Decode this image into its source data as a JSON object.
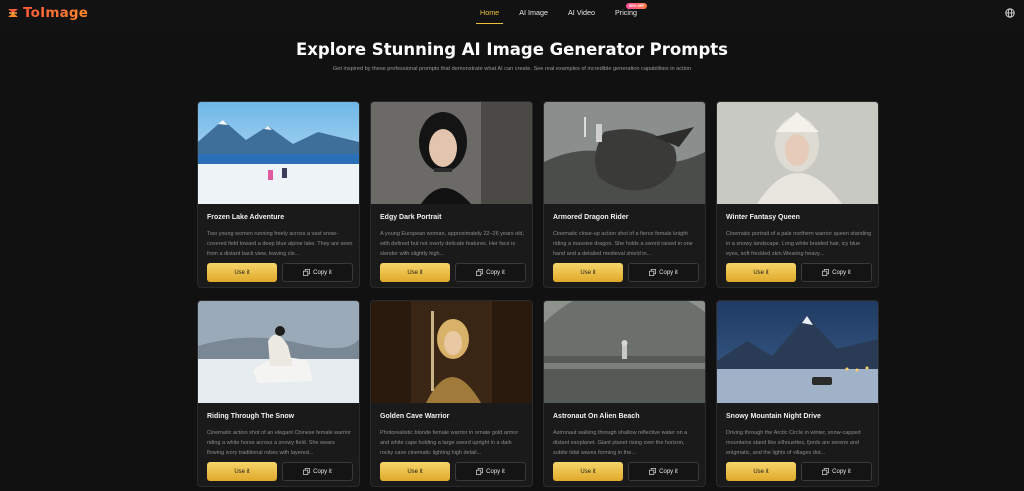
{
  "header": {
    "logo_text": "ToImage",
    "nav": [
      {
        "label": "Home",
        "active": true
      },
      {
        "label": "AI Image",
        "active": false
      },
      {
        "label": "AI Video",
        "active": false
      },
      {
        "label": "Pricing",
        "active": false
      }
    ],
    "pricing_badge": "50% OFF",
    "language_icon": "globe-icon"
  },
  "hero": {
    "title": "Explore Stunning AI Image Generator Prompts",
    "subtitle": "Get inspired by these professional prompts that demonstrate what AI can create. See real examples of incredible generation capabilities in action"
  },
  "buttons": {
    "use_label": "Use it",
    "copy_label": "Copy it",
    "copy_icon": "copy-icon"
  },
  "cards": [
    {
      "title": "Frozen Lake Adventure",
      "description": "Two young women running freely across a vast snow-covered field toward a deep blue alpine lake. They are seen from a distant back view, leaving cle..."
    },
    {
      "title": "Edgy Dark Portrait",
      "description": "A young European woman, approximately 22–26 years old, with defined but not overly delicate features. Her face is slender with slightly high..."
    },
    {
      "title": "Armored Dragon Rider",
      "description": "Cinematic close-up action shot of a fierce female knight riding a massive dragon. She holds a sword raised in one hand and a detailed medieval shield in..."
    },
    {
      "title": "Winter Fantasy Queen",
      "description": "Cinematic portrait of a pale northern warrior queen standing in a snowy landscape. Long white braided hair, icy blue eyes, soft freckled skin.Wearing heavy..."
    },
    {
      "title": "Riding Through The Snow",
      "description": "Cinematic action shot of an elegant Chinese female warrior riding a white horse across a snowy field. She wears flowing ivory traditional robes with layered..."
    },
    {
      "title": "Golden Cave Warrior",
      "description": "Photorealistic blonde female warrior in ornate gold armor and white cape holding a large sword upright in a dark rocky cave cinematic lighting high detail..."
    },
    {
      "title": "Astronaut On Alien Beach",
      "description": "Astronaut walking through shallow reflective water on a distant exoplanet. Giant planet rising over the horizon, subtle tidal waves forming in the..."
    },
    {
      "title": "Snowy Mountain Night Drive",
      "description": "Driving through the Arctic Circle in winter, snow-capped mountains stand like silhouettes, fjords are serene and enigmatic, and the lights of villages dot..."
    }
  ]
}
